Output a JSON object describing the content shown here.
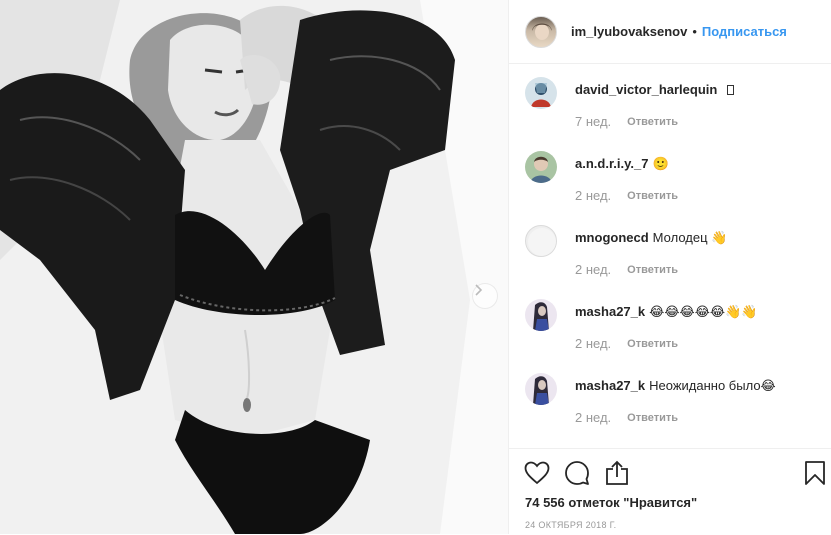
{
  "post": {
    "username": "im_lyubovaksenov",
    "separator": "•",
    "follow_label": "Подписаться"
  },
  "comments": [
    {
      "user": "david_victor_harlequin",
      "text": " ",
      "time": "7 нед.",
      "reply": "Ответить",
      "avatar_color": "#8fb6c9"
    },
    {
      "user": "a.n.d.r.i.y._7",
      "text": "🙂",
      "time": "2 нед.",
      "reply": "Ответить",
      "avatar_color": "#6f8f6a"
    },
    {
      "user": "mnogonecd",
      "text": "Молодец 👋",
      "time": "2 нед.",
      "reply": "Ответить",
      "avatar_color": "#e6e6e6"
    },
    {
      "user": "masha27_k",
      "text": "😂😂😂😂😂👋👋",
      "time": "2 нед.",
      "reply": "Ответить",
      "avatar_color": "#3f3b4f"
    },
    {
      "user": "masha27_k",
      "text": "Неожиданно было😂",
      "time": "2 нед.",
      "reply": "Ответить",
      "avatar_color": "#3f3b4f"
    }
  ],
  "actions": {
    "like_icon": "heart-icon",
    "comment_icon": "comment-icon",
    "share_icon": "share-icon",
    "save_icon": "bookmark-icon"
  },
  "likes_text": "74 556 отметок \"Нравится\"",
  "date_text": "24 ОКТЯБРЯ 2018 Г.",
  "colors": {
    "link_blue": "#3897f0",
    "text": "#262626",
    "muted": "#999999",
    "border": "#efefef"
  }
}
